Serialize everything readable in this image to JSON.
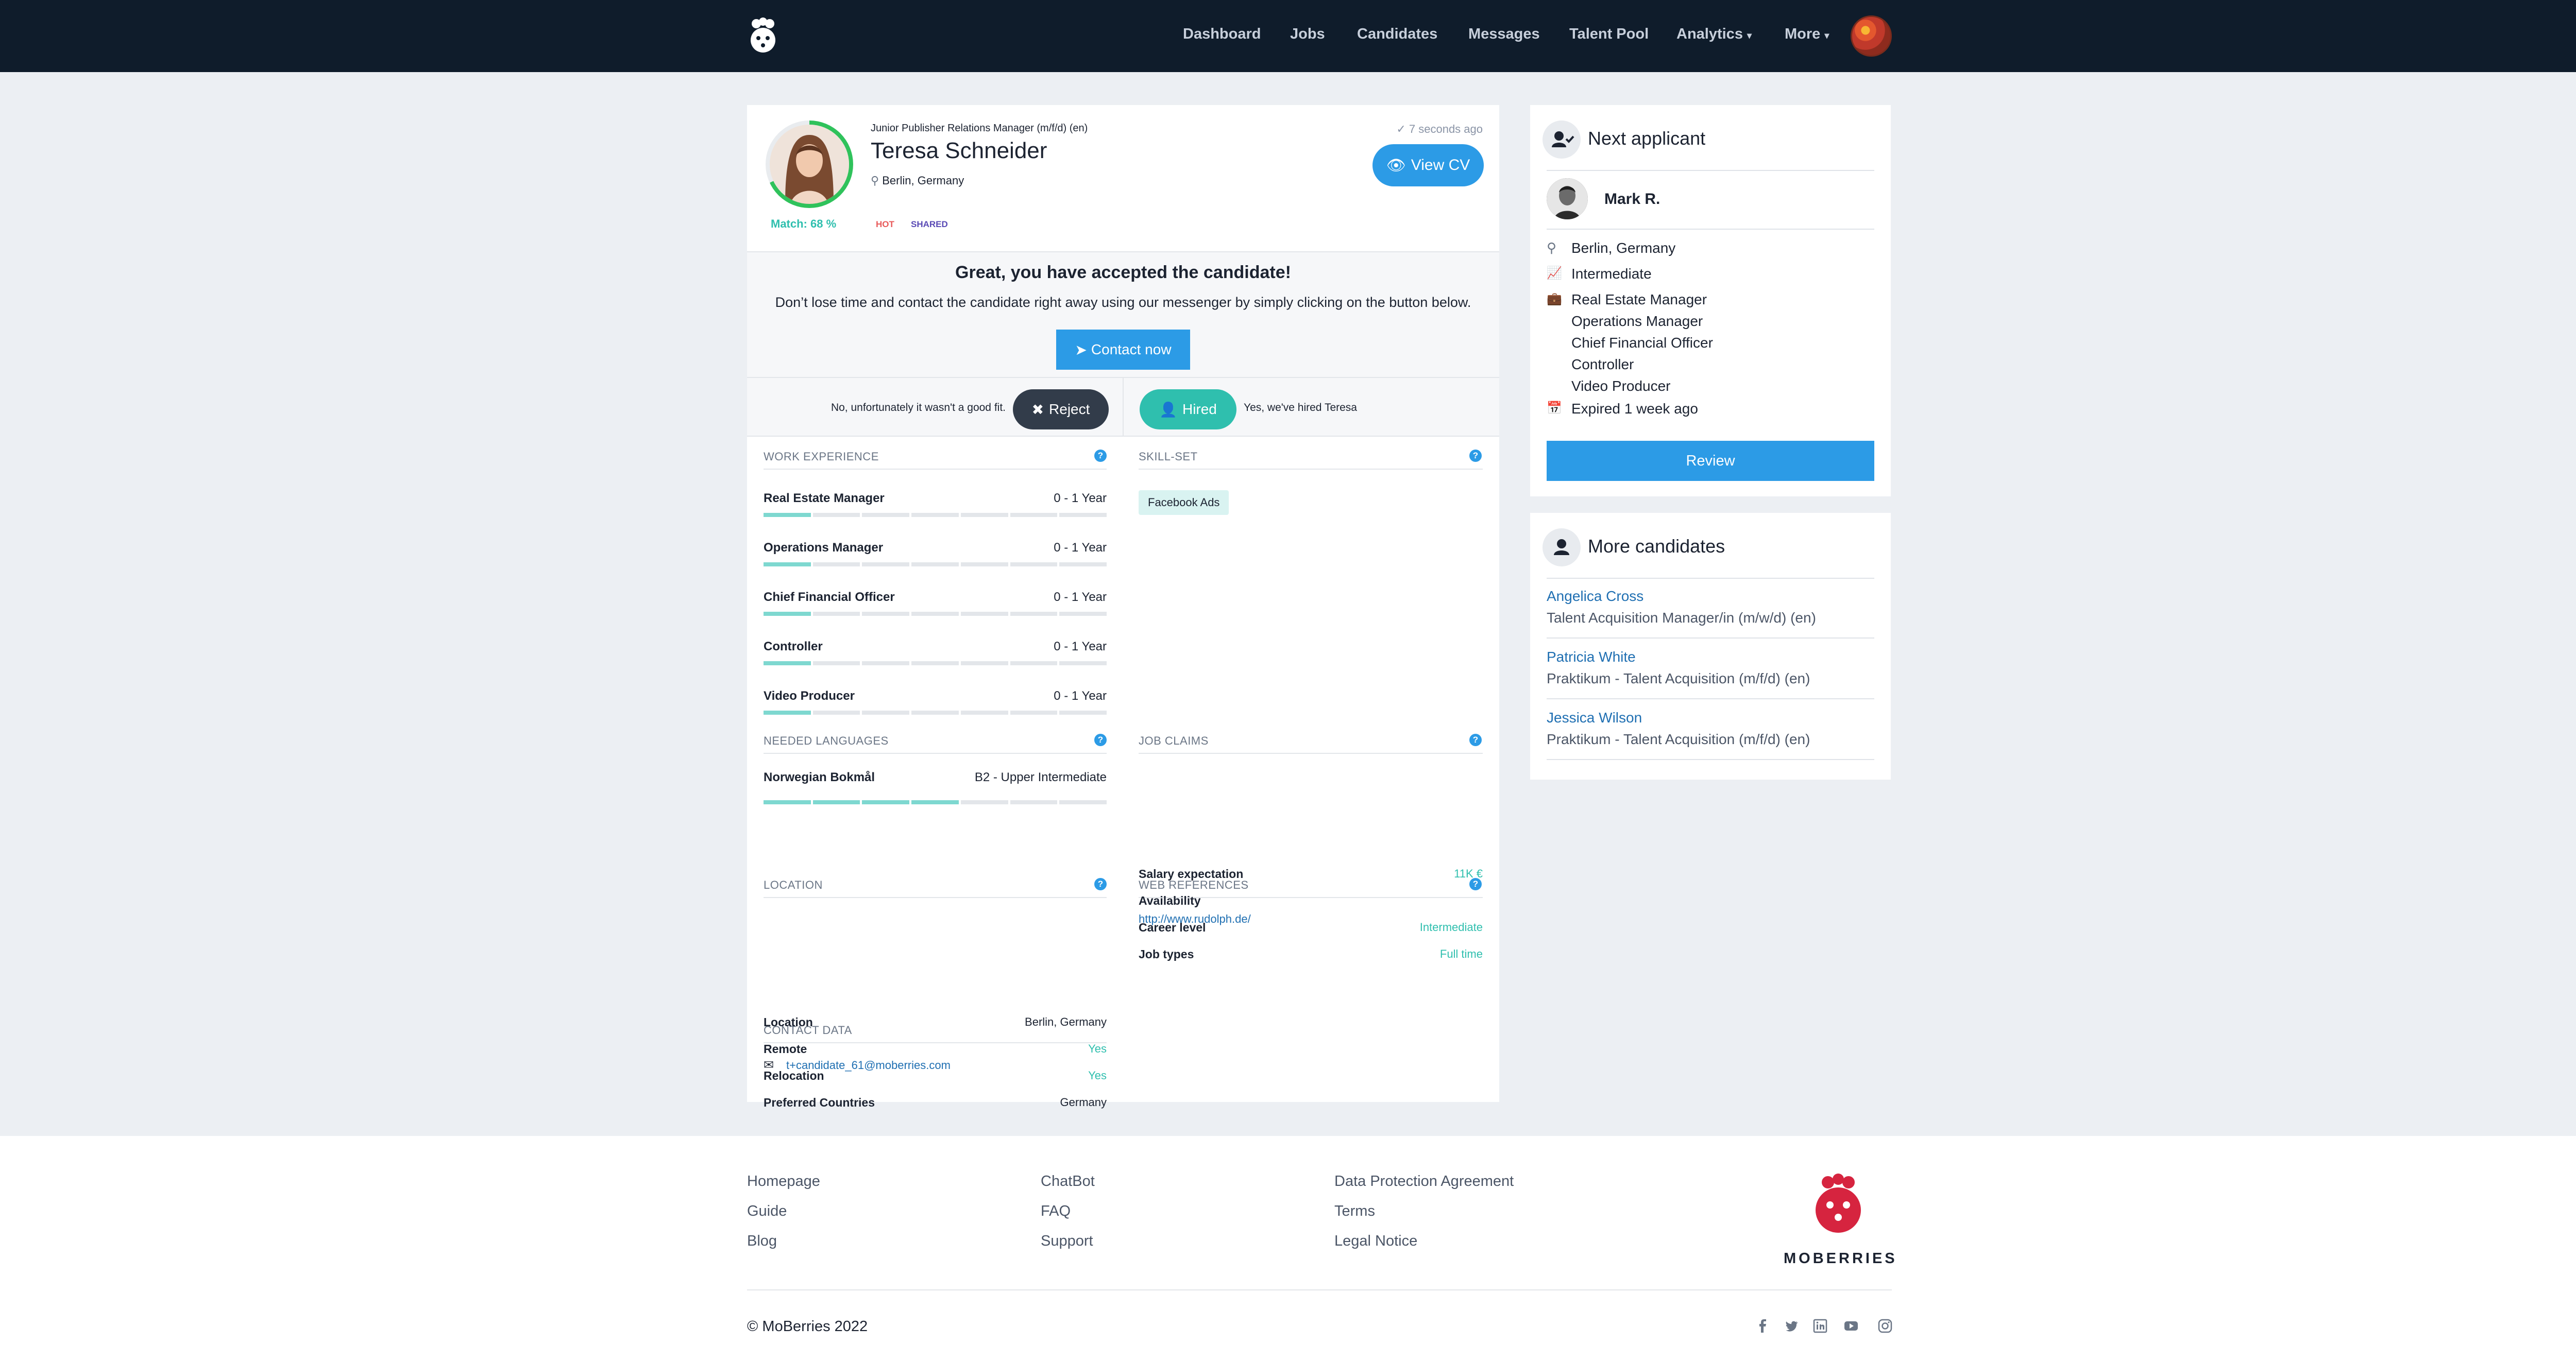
{
  "nav": {
    "items": [
      "Dashboard",
      "Jobs",
      "Candidates",
      "Messages",
      "Talent Pool",
      "Analytics",
      "More"
    ],
    "dropdown_items": [
      "Analytics",
      "More"
    ]
  },
  "candidate": {
    "job_title": "Junior Publisher Relations Manager (m/f/d) (en)",
    "name": "Teresa Schneider",
    "location": "Berlin, Germany",
    "match_label": "Match: 68 %",
    "match_percent": 68,
    "badges": [
      "HOT",
      "SHARED"
    ],
    "updated": "7 seconds ago",
    "view_cv": "View CV"
  },
  "accept": {
    "title": "Great, you have accepted the candidate!",
    "text": "Don’t lose time and contact the candidate right away using our messenger by simply clicking on the button below.",
    "contact_button": "Contact now"
  },
  "decision": {
    "no_text": "No, unfortunately it wasn't a good fit.",
    "reject": "Reject",
    "hired": "Hired",
    "yes_text": "Yes, we've hired Teresa"
  },
  "work_experience": {
    "heading": "WORK EXPERIENCE",
    "items": [
      {
        "title": "Real Estate Manager",
        "duration": "0 - 1 Year",
        "level": 1
      },
      {
        "title": "Operations Manager",
        "duration": "0 - 1 Year",
        "level": 1
      },
      {
        "title": "Chief Financial Officer",
        "duration": "0 - 1 Year",
        "level": 1
      },
      {
        "title": "Controller",
        "duration": "0 - 1 Year",
        "level": 1
      },
      {
        "title": "Video Producer",
        "duration": "0 - 1 Year",
        "level": 1
      }
    ]
  },
  "skills": {
    "heading": "SKILL-SET",
    "items": [
      "Facebook Ads"
    ]
  },
  "languages": {
    "heading": "NEEDED LANGUAGES",
    "items": [
      {
        "name": "Norwegian Bokmål",
        "level": "B2 - Upper Intermediate",
        "filled": 4
      }
    ]
  },
  "job_claims": {
    "heading": "JOB CLAIMS",
    "rows": [
      {
        "label": "Salary expectation",
        "value": "11K €"
      },
      {
        "label": "Availability",
        "value": ""
      },
      {
        "label": "Career level",
        "value": "Intermediate"
      },
      {
        "label": "Job types",
        "value": "Full time"
      }
    ]
  },
  "location": {
    "heading": "LOCATION",
    "rows": [
      {
        "label": "Location",
        "value": "Berlin, Germany"
      },
      {
        "label": "Remote",
        "value": "Yes"
      },
      {
        "label": "Relocation",
        "value": "Yes"
      },
      {
        "label": "Preferred Countries",
        "value": "Germany"
      }
    ]
  },
  "web_references": {
    "heading": "WEB REFERENCES",
    "links": [
      "http://www.rudolph.de/"
    ]
  },
  "contact": {
    "heading": "CONTACT DATA",
    "email": "t+candidate_61@moberries.com"
  },
  "next_applicant": {
    "title": "Next applicant",
    "name": "Mark R.",
    "location": "Berlin, Germany",
    "level": "Intermediate",
    "jobs": [
      "Real Estate Manager",
      "Operations Manager",
      "Chief Financial Officer",
      "Controller",
      "Video Producer"
    ],
    "expired": "Expired 1 week ago",
    "review": "Review"
  },
  "more_candidates": {
    "title": "More candidates",
    "items": [
      {
        "name": "Angelica Cross",
        "job": "Talent Acquisition Manager/in (m/w/d) (en)"
      },
      {
        "name": "Patricia White",
        "job": "Praktikum - Talent Acquisition (m/f/d) (en)"
      },
      {
        "name": "Jessica Wilson",
        "job": "Praktikum - Talent Acquisition (m/f/d) (en)"
      }
    ]
  },
  "footer": {
    "col1": [
      "Homepage",
      "Guide",
      "Blog"
    ],
    "col2": [
      "ChatBot",
      "FAQ",
      "Support"
    ],
    "col3": [
      "Data Protection Agreement",
      "Terms",
      "Legal Notice"
    ],
    "brand": "MOBERRIES",
    "copyright": "© MoBerries 2022",
    "social": [
      "facebook-icon",
      "twitter-icon",
      "linkedin-icon",
      "youtube-icon",
      "instagram-icon"
    ]
  },
  "colors": {
    "navbar": "#0f1c2b",
    "primary": "#2c9be6",
    "teal": "#2fbfae",
    "dark_button": "#323c4a",
    "hot": "#e85a5a",
    "shared": "#5a4ab5",
    "brand_red": "#d6243f"
  }
}
